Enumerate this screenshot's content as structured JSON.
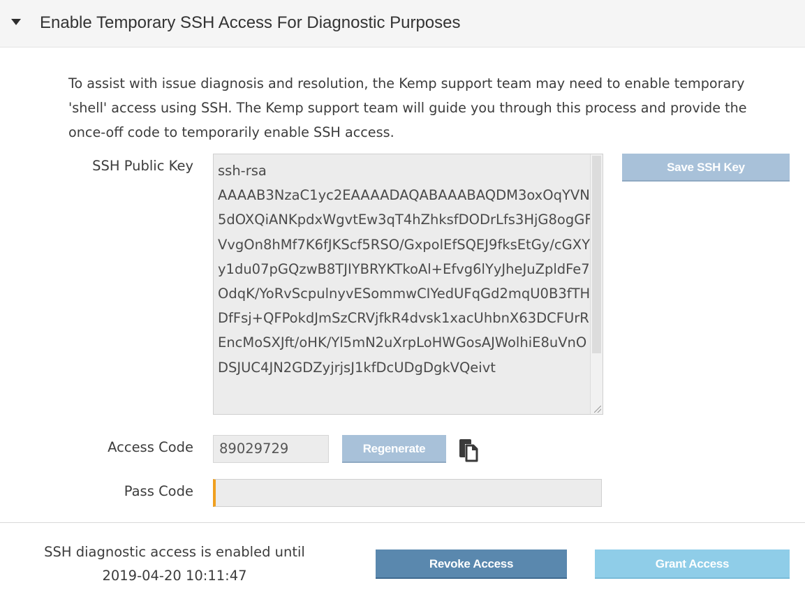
{
  "section": {
    "title": "Enable Temporary SSH Access For Diagnostic Purposes"
  },
  "description": "To assist with issue diagnosis and resolution, the Kemp support team may need to enable temporary 'shell' access using SSH. The Kemp support team will guide you through this process and provide the once-off code to temporarily enable SSH access.",
  "ssh_key": {
    "label": "SSH Public Key",
    "value": "ssh-rsa\nAAAAB3NzaC1yc2EAAAADAQABAAABAQDM3oxOqYVN5dOXQiANKpdxWgvtEw3qT4hZhksfDODrLfs3HjG8ogGFVvgOn8hMf7K6fJKScf5RSO/GxpolEfSQEJ9fksEtGy/cGXYy1du07pGQzwB8TJIYBRYKTkoAl+Efvg6lYyJheJuZpldFe7OdqK/YoRvScpulnyvESommwCIYedUFqGd2mqU0B3fTHDfFsj+QFPokdJmSzCRVjfkR4dvsk1xacUhbnX63DCFUrREncMoSXJft/oHK/Yl5mN2uXrpLoHWGosAJWolhiE8uVnODSJUC4JN2GDZyjrjsJ1kfDcUDgDgkVQeivt",
    "save_label": "Save SSH Key"
  },
  "access_code": {
    "label": "Access Code",
    "value": "89029729",
    "regenerate_label": "Regenerate",
    "copy_icon": "copy-to-clipboard-icon"
  },
  "pass_code": {
    "label": "Pass Code",
    "value": ""
  },
  "status": {
    "line1": "SSH diagnostic access is enabled until",
    "line2": "2019-04-20 10:11:47"
  },
  "actions": {
    "revoke_label": "Revoke Access",
    "grant_label": "Grant Access"
  },
  "colors": {
    "revoke": "#5a88ae",
    "grant": "#8fcde8",
    "save": "#a8c1d9",
    "pass_accent": "#f0a020"
  }
}
